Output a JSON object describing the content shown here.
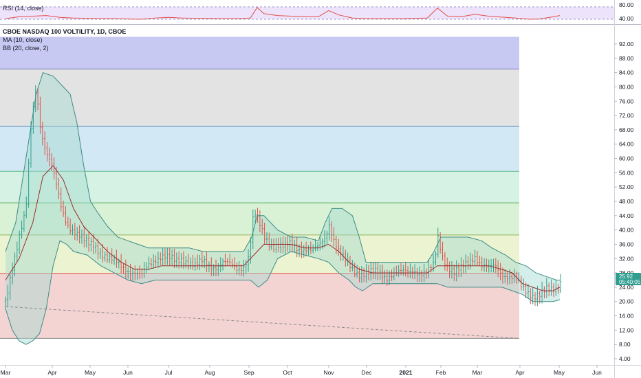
{
  "rsi_pane": {
    "label": "RSI (14, close)",
    "axis_ticks": [
      "80.00",
      "40.00"
    ],
    "band": [
      30,
      70
    ],
    "series_color": "#e2504b",
    "band_fill": "#ede3fa"
  },
  "main_pane": {
    "legend": {
      "title": "CBOE NASDAQ 100 VOLTILITY, 1D, CBOE",
      "ma": "MA (10, close)",
      "bb": "BB (20, close, 2)"
    },
    "last_price": "25.92",
    "countdown": "05:40:05",
    "y_axis_ticks": [
      "4.00",
      "8.00",
      "12.00",
      "16.00",
      "20.00",
      "24.00",
      "28.00",
      "32.00",
      "36.00",
      "40.00",
      "44.00",
      "48.00",
      "52.00",
      "56.00",
      "60.00",
      "64.00",
      "68.00",
      "72.00",
      "76.00",
      "80.00",
      "84.00",
      "88.00",
      "92.00"
    ],
    "x_axis_ticks": [
      "Mar",
      "Apr",
      "May",
      "Jun",
      "Jul",
      "Aug",
      "Sep",
      "Oct",
      "Nov",
      "Dec",
      "2021",
      "Feb",
      "Mar",
      "Apr",
      "May",
      "Jun"
    ],
    "colors": {
      "up": "#2e9e8f",
      "down": "#e2504b",
      "ma": "#9b2c2c",
      "bb_band": "#3a8c86",
      "bb_fill": "#a5d9cf",
      "accent": "#2962ff"
    },
    "zones": [
      {
        "from": 85,
        "to": 94,
        "color": "#c7c9f2"
      },
      {
        "from": 69,
        "to": 85,
        "color": "#e3e3e3"
      },
      {
        "from": 56.4,
        "to": 69,
        "color": "#d3e8f5"
      },
      {
        "from": 47.6,
        "to": 56.4,
        "color": "#d5f2e4"
      },
      {
        "from": 38.6,
        "to": 47.6,
        "color": "#d9f1d5"
      },
      {
        "from": 27.9,
        "to": 38.6,
        "color": "#ecf3d0"
      },
      {
        "from": 9.7,
        "to": 27.9,
        "color": "#f4d3d3"
      }
    ],
    "zone_lines": [
      {
        "value": 85,
        "color": "#7b7dc4"
      },
      {
        "value": 69,
        "color": "#4f7fb5"
      },
      {
        "value": 56.4,
        "color": "#5fb98a"
      },
      {
        "value": 47.6,
        "color": "#57b05a"
      },
      {
        "value": 38.6,
        "color": "#8fb35a"
      },
      {
        "value": 27.9,
        "color": "#e2504b"
      },
      {
        "value": 9.7,
        "color": "#8c8c8c"
      }
    ]
  },
  "chart_data": {
    "type": "line",
    "title": "CBOE NASDAQ 100 VOLTILITY, 1D, CBOE",
    "ylabel": "",
    "xlabel": "",
    "ylim": [
      2,
      94
    ],
    "grid": false,
    "legend_position": "top-left",
    "x": [
      "Mar",
      "Apr",
      "May",
      "Jun",
      "Jul",
      "Aug",
      "Sep",
      "Oct",
      "Nov",
      "Dec",
      "2021",
      "Feb",
      "Mar",
      "Apr",
      "May"
    ],
    "series": [
      {
        "name": "MA (10, close)",
        "values": [
          26,
          58,
          38,
          30,
          31,
          29,
          36,
          35,
          36,
          27,
          27,
          28,
          29,
          23,
          24
        ]
      },
      {
        "name": "BB (20, close, 2)",
        "values": [
          12,
          82,
          45,
          34,
          34,
          33,
          45,
          38,
          46,
          29,
          29,
          38,
          34,
          28,
          27
        ]
      }
    ],
    "price_path": [
      [
        0,
        20
      ],
      [
        10,
        30
      ],
      [
        20,
        38
      ],
      [
        30,
        45
      ],
      [
        38,
        70
      ],
      [
        45,
        80
      ],
      [
        52,
        68
      ],
      [
        60,
        62
      ],
      [
        68,
        58
      ],
      [
        75,
        52
      ],
      [
        82,
        46
      ],
      [
        90,
        42
      ],
      [
        100,
        40
      ],
      [
        110,
        38
      ],
      [
        120,
        36
      ],
      [
        130,
        36
      ],
      [
        140,
        34
      ],
      [
        150,
        32
      ],
      [
        160,
        31
      ],
      [
        170,
        30
      ],
      [
        180,
        29
      ],
      [
        190,
        28
      ],
      [
        200,
        27
      ],
      [
        210,
        30
      ],
      [
        220,
        32
      ],
      [
        230,
        33
      ],
      [
        240,
        32
      ],
      [
        250,
        31
      ],
      [
        260,
        32
      ],
      [
        270,
        31
      ],
      [
        280,
        30
      ],
      [
        290,
        31
      ],
      [
        300,
        30
      ],
      [
        310,
        30
      ],
      [
        320,
        31
      ],
      [
        330,
        30
      ],
      [
        340,
        29
      ],
      [
        350,
        30
      ],
      [
        358,
        33
      ],
      [
        365,
        45
      ],
      [
        372,
        42
      ],
      [
        380,
        38
      ],
      [
        390,
        36
      ],
      [
        400,
        36
      ],
      [
        410,
        35
      ],
      [
        420,
        36
      ],
      [
        430,
        35
      ],
      [
        440,
        35
      ],
      [
        450,
        34
      ],
      [
        460,
        35
      ],
      [
        470,
        38
      ],
      [
        476,
        42
      ],
      [
        482,
        38
      ],
      [
        490,
        34
      ],
      [
        500,
        31
      ],
      [
        510,
        29
      ],
      [
        520,
        28
      ],
      [
        530,
        28
      ],
      [
        540,
        28
      ],
      [
        550,
        28
      ],
      [
        560,
        27
      ],
      [
        570,
        28
      ],
      [
        580,
        28
      ],
      [
        590,
        28
      ],
      [
        600,
        29
      ],
      [
        610,
        28
      ],
      [
        620,
        28
      ],
      [
        630,
        30
      ],
      [
        636,
        38
      ],
      [
        642,
        33
      ],
      [
        650,
        30
      ],
      [
        660,
        28
      ],
      [
        670,
        29
      ],
      [
        680,
        31
      ],
      [
        690,
        33
      ],
      [
        700,
        30
      ],
      [
        710,
        29
      ],
      [
        720,
        30
      ],
      [
        730,
        28
      ],
      [
        740,
        27
      ],
      [
        750,
        26
      ],
      [
        758,
        24
      ],
      [
        765,
        23
      ],
      [
        775,
        22
      ],
      [
        785,
        22
      ],
      [
        795,
        23
      ],
      [
        805,
        23
      ],
      [
        812,
        24
      ],
      [
        816,
        25.92
      ]
    ],
    "ma_path": [
      [
        0,
        26
      ],
      [
        20,
        32
      ],
      [
        40,
        42
      ],
      [
        55,
        55
      ],
      [
        70,
        58
      ],
      [
        85,
        54
      ],
      [
        100,
        46
      ],
      [
        115,
        41
      ],
      [
        130,
        38
      ],
      [
        150,
        34
      ],
      [
        170,
        31
      ],
      [
        190,
        29
      ],
      [
        210,
        29
      ],
      [
        230,
        30
      ],
      [
        250,
        30
      ],
      [
        270,
        30
      ],
      [
        290,
        30
      ],
      [
        310,
        30
      ],
      [
        330,
        30
      ],
      [
        350,
        30
      ],
      [
        365,
        33
      ],
      [
        380,
        36
      ],
      [
        400,
        36
      ],
      [
        420,
        36
      ],
      [
        440,
        35
      ],
      [
        460,
        35
      ],
      [
        475,
        36
      ],
      [
        490,
        34
      ],
      [
        505,
        31
      ],
      [
        520,
        29
      ],
      [
        540,
        28
      ],
      [
        560,
        28
      ],
      [
        580,
        28
      ],
      [
        600,
        28
      ],
      [
        620,
        28
      ],
      [
        635,
        30
      ],
      [
        650,
        30
      ],
      [
        670,
        30
      ],
      [
        690,
        30
      ],
      [
        710,
        30
      ],
      [
        730,
        29
      ],
      [
        745,
        28
      ],
      [
        760,
        25
      ],
      [
        775,
        24
      ],
      [
        790,
        23
      ],
      [
        805,
        23
      ],
      [
        815,
        24
      ]
    ],
    "bb_upper_path": [
      [
        0,
        34
      ],
      [
        15,
        42
      ],
      [
        30,
        60
      ],
      [
        45,
        78
      ],
      [
        55,
        84
      ],
      [
        70,
        83
      ],
      [
        85,
        80
      ],
      [
        95,
        78
      ],
      [
        105,
        70
      ],
      [
        115,
        58
      ],
      [
        125,
        48
      ],
      [
        135,
        45
      ],
      [
        150,
        41
      ],
      [
        165,
        38
      ],
      [
        180,
        37
      ],
      [
        195,
        36
      ],
      [
        210,
        35
      ],
      [
        230,
        35
      ],
      [
        250,
        35
      ],
      [
        270,
        35
      ],
      [
        290,
        34
      ],
      [
        310,
        34
      ],
      [
        330,
        34
      ],
      [
        350,
        34
      ],
      [
        362,
        38
      ],
      [
        370,
        44
      ],
      [
        380,
        44
      ],
      [
        400,
        40
      ],
      [
        420,
        38
      ],
      [
        440,
        38
      ],
      [
        460,
        37
      ],
      [
        470,
        42
      ],
      [
        480,
        46
      ],
      [
        495,
        46
      ],
      [
        510,
        44
      ],
      [
        520,
        38
      ],
      [
        530,
        31
      ],
      [
        545,
        31
      ],
      [
        560,
        31
      ],
      [
        580,
        31
      ],
      [
        600,
        31
      ],
      [
        620,
        31
      ],
      [
        630,
        34
      ],
      [
        640,
        38
      ],
      [
        660,
        38
      ],
      [
        680,
        38
      ],
      [
        700,
        37
      ],
      [
        715,
        35
      ],
      [
        735,
        33
      ],
      [
        750,
        31
      ],
      [
        765,
        30
      ],
      [
        780,
        28
      ],
      [
        795,
        27
      ],
      [
        810,
        26
      ],
      [
        815,
        26
      ]
    ],
    "bb_lower_path": [
      [
        0,
        18
      ],
      [
        10,
        12
      ],
      [
        20,
        9
      ],
      [
        30,
        8
      ],
      [
        40,
        9
      ],
      [
        50,
        11
      ],
      [
        60,
        18
      ],
      [
        70,
        30
      ],
      [
        80,
        37
      ],
      [
        90,
        36
      ],
      [
        100,
        34
      ],
      [
        120,
        33
      ],
      [
        140,
        30
      ],
      [
        160,
        28
      ],
      [
        180,
        26
      ],
      [
        200,
        25
      ],
      [
        220,
        26
      ],
      [
        240,
        26
      ],
      [
        260,
        26
      ],
      [
        280,
        26
      ],
      [
        300,
        26
      ],
      [
        320,
        26
      ],
      [
        340,
        26
      ],
      [
        360,
        26
      ],
      [
        372,
        24
      ],
      [
        385,
        26
      ],
      [
        400,
        32
      ],
      [
        420,
        34
      ],
      [
        440,
        33
      ],
      [
        460,
        32
      ],
      [
        475,
        31
      ],
      [
        490,
        28
      ],
      [
        505,
        26
      ],
      [
        515,
        24
      ],
      [
        525,
        23
      ],
      [
        540,
        25
      ],
      [
        560,
        25
      ],
      [
        580,
        25
      ],
      [
        600,
        25
      ],
      [
        620,
        25
      ],
      [
        635,
        25
      ],
      [
        650,
        24
      ],
      [
        670,
        24
      ],
      [
        690,
        24
      ],
      [
        710,
        24
      ],
      [
        730,
        24
      ],
      [
        745,
        23
      ],
      [
        760,
        22
      ],
      [
        775,
        20
      ],
      [
        790,
        20
      ],
      [
        805,
        20
      ],
      [
        815,
        20.5
      ]
    ],
    "rsi_path": [
      [
        0,
        42
      ],
      [
        20,
        48
      ],
      [
        40,
        50
      ],
      [
        60,
        52
      ],
      [
        80,
        46
      ],
      [
        100,
        44
      ],
      [
        120,
        43
      ],
      [
        140,
        42
      ],
      [
        160,
        42
      ],
      [
        180,
        41
      ],
      [
        200,
        40
      ],
      [
        220,
        44
      ],
      [
        240,
        46
      ],
      [
        260,
        44
      ],
      [
        280,
        43
      ],
      [
        300,
        43
      ],
      [
        320,
        42
      ],
      [
        340,
        42
      ],
      [
        360,
        44
      ],
      [
        370,
        78
      ],
      [
        380,
        58
      ],
      [
        400,
        52
      ],
      [
        420,
        50
      ],
      [
        440,
        48
      ],
      [
        460,
        48
      ],
      [
        475,
        68
      ],
      [
        490,
        54
      ],
      [
        510,
        44
      ],
      [
        530,
        42
      ],
      [
        560,
        42
      ],
      [
        580,
        42
      ],
      [
        600,
        43
      ],
      [
        620,
        44
      ],
      [
        635,
        76
      ],
      [
        650,
        50
      ],
      [
        670,
        48
      ],
      [
        690,
        56
      ],
      [
        710,
        50
      ],
      [
        730,
        47
      ],
      [
        750,
        44
      ],
      [
        770,
        40
      ],
      [
        785,
        41
      ],
      [
        800,
        46
      ],
      [
        815,
        52
      ]
    ],
    "trendline": [
      [
        0,
        18.6
      ],
      [
        755,
        9.7
      ]
    ]
  }
}
